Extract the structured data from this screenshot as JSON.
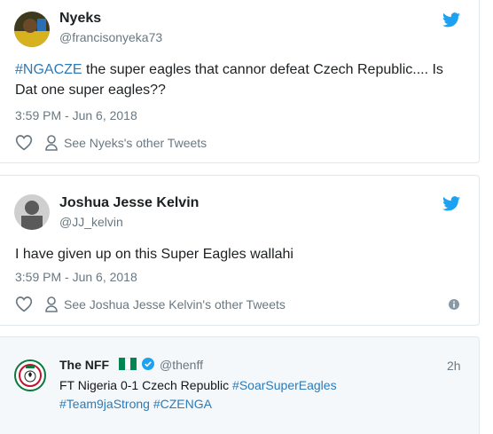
{
  "tweets": [
    {
      "name": "Nyeks",
      "handle": "@francisonyeka73",
      "hashtag": "#NGACZE",
      "text": " the super eagles that cannor defeat Czech Republic.... Is Dat one super eagles??",
      "time": "3:59 PM - Jun 6, 2018",
      "other_tweets": "See Nyeks's other Tweets",
      "avatar_colors": [
        "#3f3a1e",
        "#d8b21e",
        "#2a6fb3"
      ]
    },
    {
      "name": "Joshua Jesse Kelvin",
      "handle": "@JJ_kelvin",
      "text": "I have given up on this Super Eagles wallahi",
      "time": "3:59 PM - Jun 6, 2018",
      "other_tweets": "See Joshua Jesse Kelvin's other Tweets",
      "avatar_colors": [
        "#cfcfcf",
        "#5a5a5a"
      ]
    }
  ],
  "embedded": {
    "name": "The NFF",
    "handle": "@thenff",
    "age": "2h",
    "text_prefix": "FT Nigeria 0-1 Czech Republic ",
    "hashtag1": "#SoarSuperEagles",
    "hashtag2": "#Team9jaStrong",
    "hashtag3": "#CZENGA",
    "flag_colors": [
      "#008751",
      "#ffffff",
      "#008751"
    ]
  },
  "colors": {
    "twitter_blue": "#1da1f2",
    "link": "#2b7bb9",
    "muted": "#697882",
    "border": "#e1e8ed"
  },
  "icons": [
    "twitter-bird-icon",
    "heart-icon",
    "person-icon",
    "info-icon",
    "verified-badge-icon"
  ]
}
